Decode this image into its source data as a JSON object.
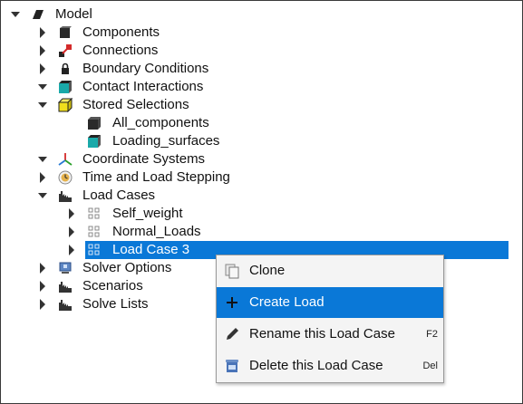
{
  "tree": {
    "model": "Model",
    "components": "Components",
    "connections": "Connections",
    "boundary_conditions": "Boundary Conditions",
    "contact_interactions": "Contact Interactions",
    "stored_selections": "Stored Selections",
    "all_components": "All_components",
    "loading_surfaces": "Loading_surfaces",
    "coordinate_systems": "Coordinate Systems",
    "time_load_stepping": "Time and Load Stepping",
    "load_cases": "Load Cases",
    "self_weight": "Self_weight",
    "normal_loads": "Normal_Loads",
    "load_case_3": "Load Case 3",
    "solver_options": "Solver Options",
    "scenarios": "Scenarios",
    "solve_lists": "Solve Lists"
  },
  "context_menu": {
    "clone": "Clone",
    "create_load": "Create Load",
    "rename": "Rename this Load Case",
    "rename_shortcut": "F2",
    "delete": "Delete this Load Case",
    "delete_shortcut": "Del"
  },
  "colors": {
    "selection": "#0a78d7"
  }
}
